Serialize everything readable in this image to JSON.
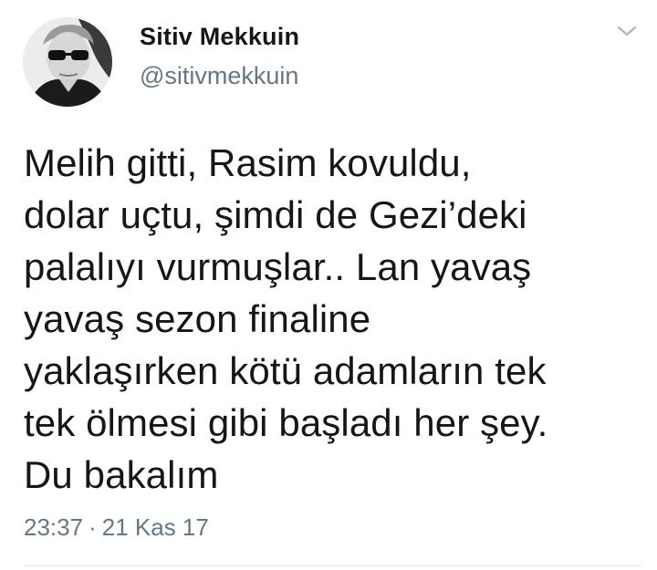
{
  "author": {
    "display_name": "Sitiv Mekkuin",
    "handle": "@sitivmekkuin"
  },
  "tweet": {
    "lines": [
      "Melih gitti, Rasim kovuldu,",
      "dolar uçtu, şimdi de Gezi’deki",
      "palalıyı vurmuşlar.. Lan yavaş",
      "yavaş sezon finaline",
      "yaklaşırken kötü adamların tek",
      "tek ölmesi gibi başladı her şey.",
      "Du bakalım"
    ]
  },
  "meta": {
    "time": "23:37",
    "separator": "·",
    "date": "21 Kas 17"
  },
  "icons": {
    "menu": "chevron-down-icon",
    "avatar": "avatar"
  },
  "colors": {
    "text": "#14171a",
    "secondary": "#657786",
    "divider": "#e1e8ed"
  }
}
